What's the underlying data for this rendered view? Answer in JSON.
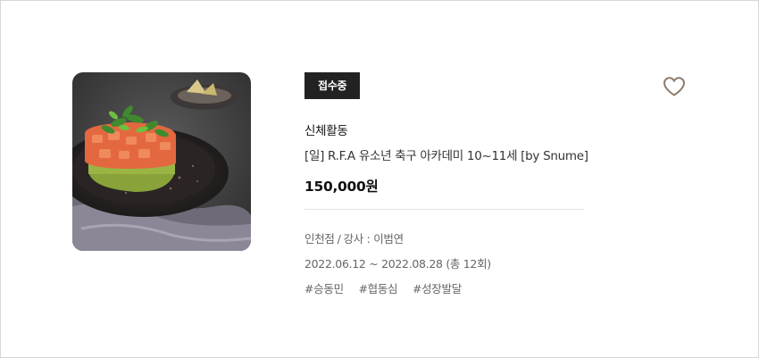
{
  "course": {
    "status_badge": "접수중",
    "category": "신체활동",
    "title": "[일] R.F.A 유소년 축구 아카데미 10~11세 [by Snume]",
    "price": "150,000원",
    "branch": "인천점",
    "instructor_label": "강사 : 이범연",
    "period": "2022.06.12 ~ 2022.08.28 (총 12회)",
    "tags": [
      "#승동민",
      "#협동심",
      "#성장발달"
    ]
  },
  "icons": {
    "wishlist": "heart-outline-icon"
  },
  "colors": {
    "badge_bg": "#222222",
    "heart_stroke": "#8c7b6b"
  }
}
